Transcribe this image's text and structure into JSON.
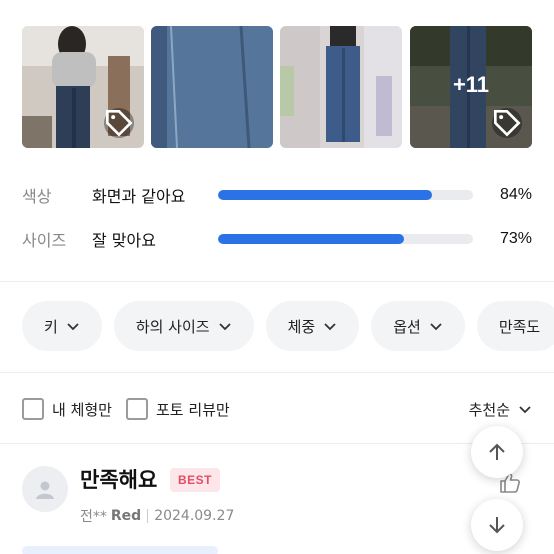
{
  "photos": {
    "items": [
      {
        "name": "review-photo-1",
        "has_tag": true
      },
      {
        "name": "review-photo-2",
        "has_tag": false
      },
      {
        "name": "review-photo-3",
        "has_tag": false
      },
      {
        "name": "review-photo-4",
        "has_tag": true
      }
    ],
    "more_count": "+11",
    "tag_icon": "tag-icon"
  },
  "ratings": [
    {
      "category": "색상",
      "answer": "화면과 같아요",
      "percent_label": "84%",
      "percent": 84
    },
    {
      "category": "사이즈",
      "answer": "잘 맞아요",
      "percent_label": "73%",
      "percent": 73
    }
  ],
  "rating_bar_color": "#2a72e5",
  "filters": {
    "chips": [
      {
        "label": "키"
      },
      {
        "label": "하의 사이즈"
      },
      {
        "label": "체중"
      },
      {
        "label": "옵션"
      },
      {
        "label": "만족도"
      }
    ],
    "chip_icon": "chevron-down-icon"
  },
  "review_filters": {
    "my_body_label": "내 체형만",
    "photo_review_label": "포토 리뷰만",
    "sort_label": "추천순"
  },
  "review": {
    "title": "만족해요",
    "badge": "BEST",
    "author": "전**",
    "option": "Red",
    "date": "2024.09.27"
  },
  "icons": {
    "like": "thumbs-up-icon",
    "scroll_up": "arrow-up-icon",
    "scroll_down": "arrow-down-icon",
    "avatar": "user-avatar-icon"
  }
}
